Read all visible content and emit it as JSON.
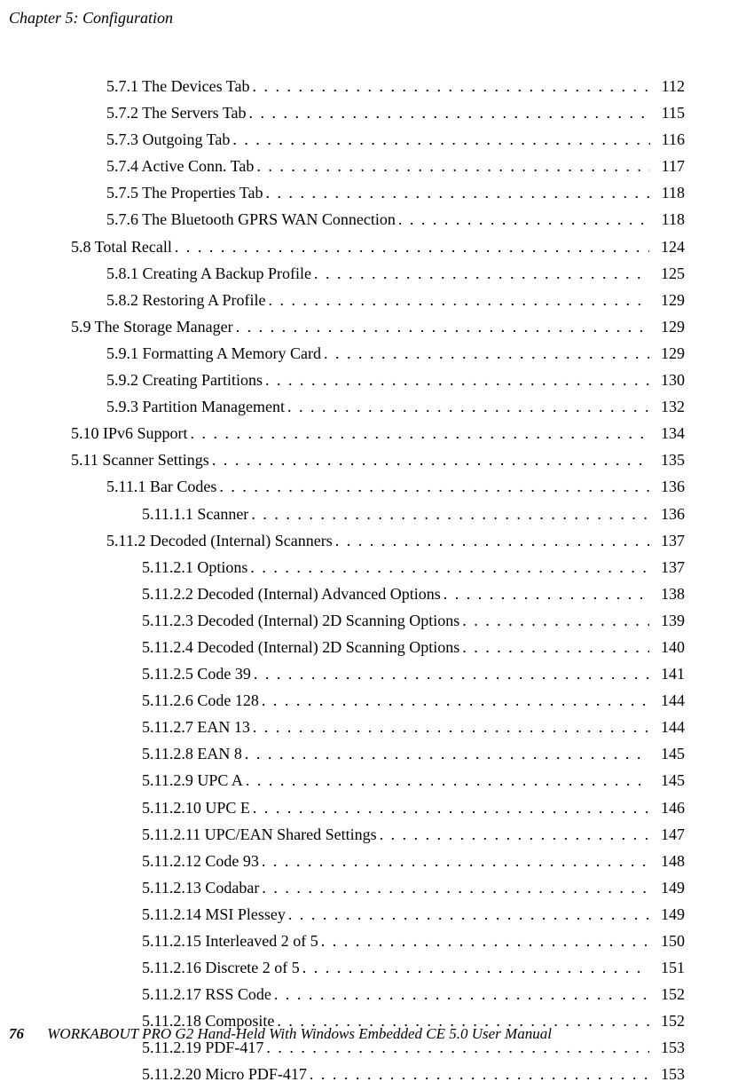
{
  "running_head": "Chapter 5: Configuration",
  "page_number": "76",
  "footer_text": "WORKABOUT PRO G2 Hand-Held With Windows Embedded CE 5.0 User Manual",
  "toc": [
    {
      "indent": 2,
      "num": "5.7.1",
      "title": "The Devices Tab",
      "page": "112"
    },
    {
      "indent": 2,
      "num": "5.7.2",
      "title": "The Servers Tab",
      "page": "115"
    },
    {
      "indent": 2,
      "num": "5.7.3",
      "title": "Outgoing Tab",
      "page": "116"
    },
    {
      "indent": 2,
      "num": "5.7.4",
      "title": "Active Conn. Tab",
      "page": "117"
    },
    {
      "indent": 2,
      "num": "5.7.5",
      "title": "The Properties Tab",
      "page": "118"
    },
    {
      "indent": 2,
      "num": "5.7.6",
      "title": "The Bluetooth GPRS WAN Connection",
      "page": "118"
    },
    {
      "indent": 1,
      "num": "5.8",
      "title": "Total Recall",
      "page": "124"
    },
    {
      "indent": 2,
      "num": "5.8.1",
      "title": "Creating A Backup Profile",
      "page": "125"
    },
    {
      "indent": 2,
      "num": "5.8.2",
      "title": "Restoring A Profile",
      "page": "129"
    },
    {
      "indent": 1,
      "num": "5.9",
      "title": "The Storage Manager",
      "page": "129"
    },
    {
      "indent": 2,
      "num": "5.9.1",
      "title": "Formatting A Memory Card",
      "page": "129"
    },
    {
      "indent": 2,
      "num": "5.9.2",
      "title": "Creating Partitions",
      "page": "130"
    },
    {
      "indent": 2,
      "num": "5.9.3",
      "title": "Partition Management",
      "page": "132"
    },
    {
      "indent": 1,
      "num": "5.10",
      "title": "IPv6 Support",
      "page": "134"
    },
    {
      "indent": 1,
      "num": "5.11",
      "title": "Scanner Settings",
      "page": "135"
    },
    {
      "indent": 2,
      "num": "5.11.1",
      "title": "Bar Codes",
      "page": "136"
    },
    {
      "indent": 3,
      "num": "5.11.1.1",
      "title": "Scanner",
      "page": "136"
    },
    {
      "indent": 2,
      "num": "5.11.2",
      "title": "Decoded (Internal) Scanners",
      "page": "137"
    },
    {
      "indent": 3,
      "num": "5.11.2.1",
      "title": "Options",
      "page": "137"
    },
    {
      "indent": 3,
      "num": "5.11.2.2",
      "title": "Decoded (Internal) Advanced Options",
      "page": "138"
    },
    {
      "indent": 3,
      "num": "5.11.2.3",
      "title": "Decoded (Internal) 2D Scanning Options",
      "page": "139"
    },
    {
      "indent": 3,
      "num": "5.11.2.4",
      "title": "Decoded (Internal) 2D Scanning Options",
      "page": "140"
    },
    {
      "indent": 3,
      "num": "5.11.2.5",
      "title": "Code 39",
      "page": "141"
    },
    {
      "indent": 3,
      "num": "5.11.2.6",
      "title": "Code 128",
      "page": "144"
    },
    {
      "indent": 3,
      "num": "5.11.2.7",
      "title": "EAN 13",
      "page": "144"
    },
    {
      "indent": 3,
      "num": "5.11.2.8",
      "title": "EAN 8",
      "page": "145"
    },
    {
      "indent": 3,
      "num": "5.11.2.9",
      "title": "UPC A",
      "page": "145"
    },
    {
      "indent": 3,
      "num": "5.11.2.10",
      "title": "UPC E",
      "page": "146"
    },
    {
      "indent": 3,
      "num": "5.11.2.11",
      "title": "UPC/EAN Shared Settings",
      "page": "147"
    },
    {
      "indent": 3,
      "num": "5.11.2.12",
      "title": "Code 93",
      "page": "148"
    },
    {
      "indent": 3,
      "num": "5.11.2.13",
      "title": "Codabar",
      "page": "149"
    },
    {
      "indent": 3,
      "num": "5.11.2.14",
      "title": "MSI Plessey",
      "page": "149"
    },
    {
      "indent": 3,
      "num": "5.11.2.15",
      "title": "Interleaved 2 of 5",
      "page": "150"
    },
    {
      "indent": 3,
      "num": "5.11.2.16",
      "title": "Discrete 2 of 5",
      "page": "151"
    },
    {
      "indent": 3,
      "num": "5.11.2.17",
      "title": "RSS Code",
      "page": "152"
    },
    {
      "indent": 3,
      "num": "5.11.2.18",
      "title": "Composite",
      "page": "152"
    },
    {
      "indent": 3,
      "num": "5.11.2.19",
      "title": "PDF-417",
      "page": "153"
    },
    {
      "indent": 3,
      "num": "5.11.2.20",
      "title": "Micro PDF-417",
      "page": "153"
    }
  ]
}
